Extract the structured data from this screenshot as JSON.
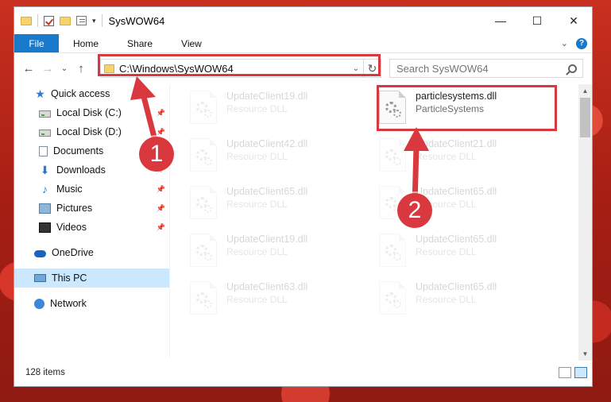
{
  "window": {
    "title": "SysWOW64",
    "controls": {
      "minimize": "—",
      "maximize": "☐",
      "close": "✕"
    }
  },
  "menu": {
    "file": "File",
    "home": "Home",
    "share": "Share",
    "view": "View"
  },
  "nav": {
    "back": "←",
    "forward": "→",
    "recent": "⌄",
    "up": "↑"
  },
  "address": {
    "path": "C:\\Windows\\SysWOW64",
    "dropdown": "⌄",
    "refresh": "↻"
  },
  "search": {
    "placeholder": "Search SysWOW64"
  },
  "sidebar": {
    "items": [
      {
        "label": "Quick access",
        "icon": "star-icon"
      },
      {
        "label": "Local Disk (C:)",
        "icon": "disk-icon",
        "pinned": true
      },
      {
        "label": "Local Disk (D:)",
        "icon": "disk-icon",
        "pinned": true
      },
      {
        "label": "Documents",
        "icon": "documents-icon",
        "pinned": true
      },
      {
        "label": "Downloads",
        "icon": "downloads-icon",
        "pinned": true
      },
      {
        "label": "Music",
        "icon": "music-icon",
        "pinned": true
      },
      {
        "label": "Pictures",
        "icon": "pictures-icon",
        "pinned": true
      },
      {
        "label": "Videos",
        "icon": "videos-icon",
        "pinned": true
      },
      {
        "label": "OneDrive",
        "icon": "onedrive-icon"
      },
      {
        "label": "This PC",
        "icon": "this-pc-icon",
        "selected": true
      },
      {
        "label": "Network",
        "icon": "network-icon"
      }
    ]
  },
  "files": {
    "highlighted": {
      "name": "particlesystems.dll",
      "type": "ParticleSystems"
    },
    "faded": [
      {
        "name": "UpdateClient19.dll",
        "type": "Resource DLL"
      },
      {
        "name": "UpdateClient42.dll",
        "type": "Resource DLL"
      },
      {
        "name": "UpdateClient21.dll",
        "type": "Resource DLL"
      },
      {
        "name": "UpdateClient65.dll",
        "type": "Resource DLL"
      },
      {
        "name": "UpdateClient65.dll",
        "type": "Resource DLL"
      },
      {
        "name": "UpdateClient19.dll",
        "type": "Resource DLL"
      },
      {
        "name": "UpdateClient65.dll",
        "type": "Resource DLL"
      },
      {
        "name": "UpdateClient63.dll",
        "type": "Resource DLL"
      },
      {
        "name": "UpdateClient65.dll",
        "type": "Resource DLL"
      }
    ]
  },
  "status": {
    "count": "128 items"
  },
  "callouts": {
    "one": "1",
    "two": "2"
  },
  "colors": {
    "accent": "#1979ca",
    "highlight": "#d9383e",
    "selected": "#cce8ff"
  }
}
